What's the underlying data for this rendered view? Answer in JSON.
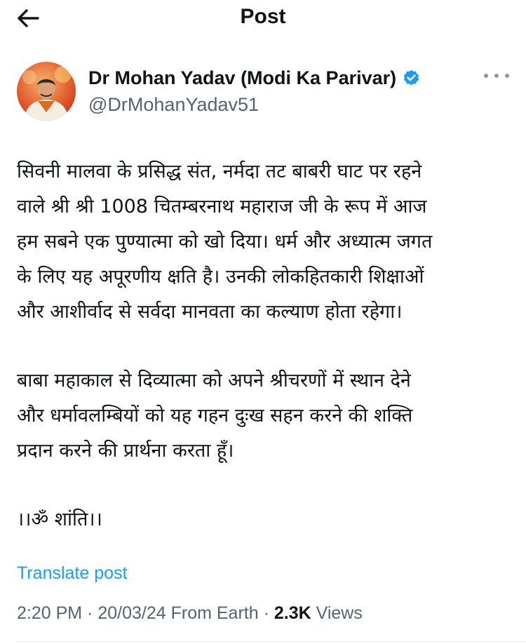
{
  "header": {
    "title": "Post"
  },
  "author": {
    "name": "Dr Mohan Yadav (Modi Ka Parivar)",
    "handle": "@DrMohanYadav51",
    "verified_color": "#1d9bf0"
  },
  "post": {
    "paragraphs": [
      "सिवनी मालवा के प्रसिद्ध संत, नर्मदा तट बाबरी घाट पर रहने\nवाले श्री श्री 1008 चितम्बरनाथ महाराज जी के रूप में आज\nहम सबने एक पुण्यात्मा को खो दिया। धर्म और अध्यात्म जगत\nके लिए यह अपूरणीय क्षति है। उनकी लोकहितकारी शिक्षाओं\nऔर आशीर्वाद से सर्वदा मानवता का कल्याण होता रहेगा।",
      "बाबा महाकाल से दिव्यात्मा को अपने श्रीचरणों में स्थान देने\nऔर धर्मावलम्बियों को यह गहन दुःख सहन करने की शक्ति\nप्रदान करने की प्रार्थना करता हूँ।",
      "।।ॐ शांति।।"
    ]
  },
  "translate_label": "Translate post",
  "meta": {
    "time": "2:20 PM",
    "date": "20/03/24",
    "source": "From Earth",
    "views_count": "2.3K",
    "views_label": "Views",
    "separator": " · "
  },
  "colors": {
    "link": "#1d9bf0",
    "secondary_text": "#536471",
    "primary_text": "#0f1419"
  }
}
